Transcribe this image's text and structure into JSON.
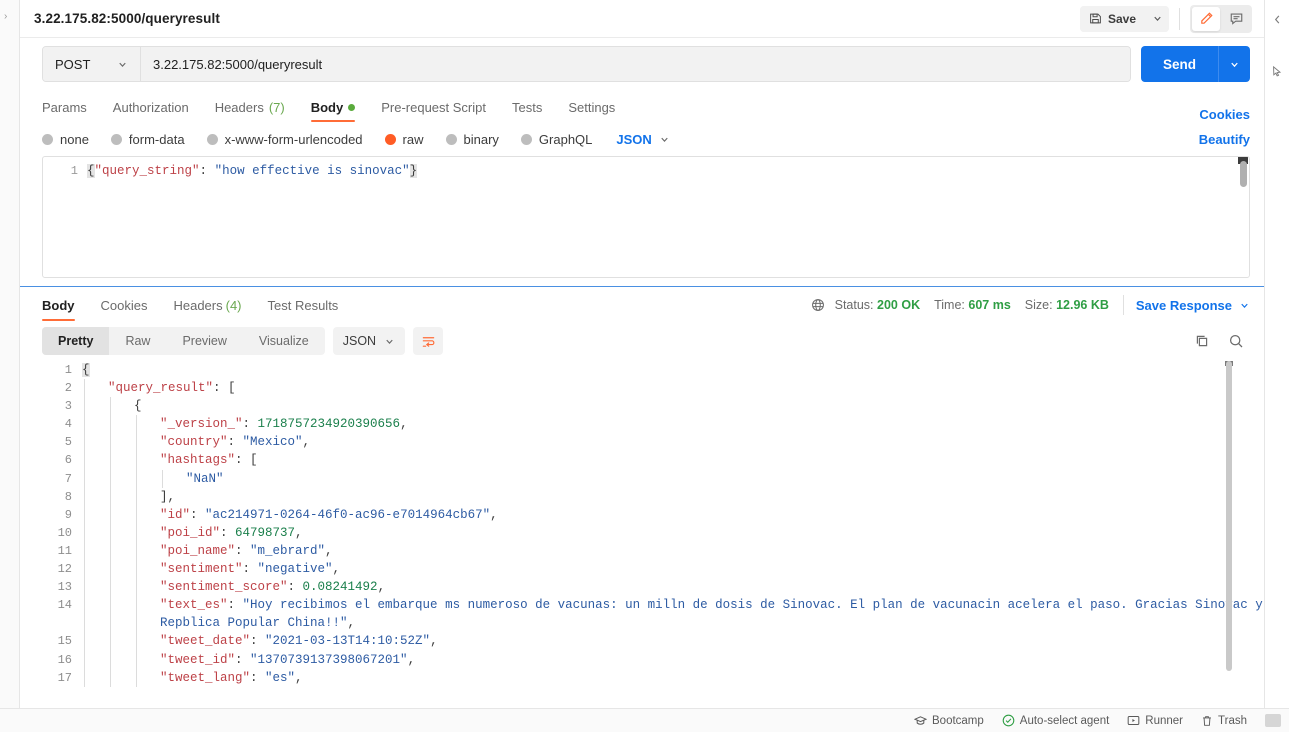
{
  "request": {
    "title": "3.22.175.82:5000/queryresult",
    "method": "POST",
    "url": "3.22.175.82:5000/queryresult",
    "send_label": "Send",
    "save_label": "Save",
    "tabs": [
      {
        "label": "Params",
        "count": "",
        "active": false
      },
      {
        "label": "Authorization",
        "count": "",
        "active": false
      },
      {
        "label": "Headers",
        "count": "(7)",
        "active": false
      },
      {
        "label": "Body",
        "count": "",
        "active": true
      },
      {
        "label": "Pre-request Script",
        "count": "",
        "active": false
      },
      {
        "label": "Tests",
        "count": "",
        "active": false
      },
      {
        "label": "Settings",
        "count": "",
        "active": false
      }
    ],
    "cookies_link": "Cookies",
    "beautify_link": "Beautify",
    "body_types": [
      {
        "label": "none",
        "selected": false
      },
      {
        "label": "form-data",
        "selected": false
      },
      {
        "label": "x-www-form-urlencoded",
        "selected": false
      },
      {
        "label": "raw",
        "selected": true
      },
      {
        "label": "binary",
        "selected": false
      },
      {
        "label": "GraphQL",
        "selected": false
      }
    ],
    "body_format": "JSON",
    "editor": {
      "line_number": "1",
      "key": "\"query_string\"",
      "colon": ": ",
      "value": "\"how effective is sinovac\""
    }
  },
  "response": {
    "tabs": [
      {
        "label": "Body",
        "count": "",
        "active": true
      },
      {
        "label": "Cookies",
        "count": "",
        "active": false
      },
      {
        "label": "Headers",
        "count": "(4)",
        "active": false
      },
      {
        "label": "Test Results",
        "count": "",
        "active": false
      }
    ],
    "status_label": "Status:",
    "status_value": "200 OK",
    "time_label": "Time:",
    "time_value": "607 ms",
    "size_label": "Size:",
    "size_value": "12.96 KB",
    "save_response": "Save Response",
    "viewer_modes": [
      {
        "label": "Pretty",
        "active": true
      },
      {
        "label": "Raw",
        "active": false
      },
      {
        "label": "Preview",
        "active": false
      },
      {
        "label": "Visualize",
        "active": false
      }
    ],
    "viewer_format": "JSON",
    "json_lines": [
      {
        "n": "1",
        "indent": 0,
        "folds": 0,
        "parts": [
          {
            "t": "brace",
            "v": "{"
          }
        ]
      },
      {
        "n": "2",
        "indent": 1,
        "folds": 1,
        "parts": [
          {
            "t": "key",
            "v": "\"query_result\""
          },
          {
            "t": "punc",
            "v": ": ["
          }
        ]
      },
      {
        "n": "3",
        "indent": 2,
        "folds": 2,
        "parts": [
          {
            "t": "punc",
            "v": "{"
          }
        ]
      },
      {
        "n": "4",
        "indent": 3,
        "folds": 3,
        "parts": [
          {
            "t": "key",
            "v": "\"_version_\""
          },
          {
            "t": "punc",
            "v": ": "
          },
          {
            "t": "num",
            "v": "1718757234920390656"
          },
          {
            "t": "punc",
            "v": ","
          }
        ]
      },
      {
        "n": "5",
        "indent": 3,
        "folds": 3,
        "parts": [
          {
            "t": "key",
            "v": "\"country\""
          },
          {
            "t": "punc",
            "v": ": "
          },
          {
            "t": "str",
            "v": "\"Mexico\""
          },
          {
            "t": "punc",
            "v": ","
          }
        ]
      },
      {
        "n": "6",
        "indent": 3,
        "folds": 3,
        "parts": [
          {
            "t": "key",
            "v": "\"hashtags\""
          },
          {
            "t": "punc",
            "v": ": ["
          }
        ]
      },
      {
        "n": "7",
        "indent": 4,
        "folds": 4,
        "parts": [
          {
            "t": "str",
            "v": "\"NaN\""
          }
        ]
      },
      {
        "n": "8",
        "indent": 3,
        "folds": 3,
        "parts": [
          {
            "t": "punc",
            "v": "],"
          }
        ]
      },
      {
        "n": "9",
        "indent": 3,
        "folds": 3,
        "parts": [
          {
            "t": "key",
            "v": "\"id\""
          },
          {
            "t": "punc",
            "v": ": "
          },
          {
            "t": "str",
            "v": "\"ac214971-0264-46f0-ac96-e7014964cb67\""
          },
          {
            "t": "punc",
            "v": ","
          }
        ]
      },
      {
        "n": "10",
        "indent": 3,
        "folds": 3,
        "parts": [
          {
            "t": "key",
            "v": "\"poi_id\""
          },
          {
            "t": "punc",
            "v": ": "
          },
          {
            "t": "num",
            "v": "64798737"
          },
          {
            "t": "punc",
            "v": ","
          }
        ]
      },
      {
        "n": "11",
        "indent": 3,
        "folds": 3,
        "parts": [
          {
            "t": "key",
            "v": "\"poi_name\""
          },
          {
            "t": "punc",
            "v": ": "
          },
          {
            "t": "str",
            "v": "\"m_ebrard\""
          },
          {
            "t": "punc",
            "v": ","
          }
        ]
      },
      {
        "n": "12",
        "indent": 3,
        "folds": 3,
        "parts": [
          {
            "t": "key",
            "v": "\"sentiment\""
          },
          {
            "t": "punc",
            "v": ": "
          },
          {
            "t": "str",
            "v": "\"negative\""
          },
          {
            "t": "punc",
            "v": ","
          }
        ]
      },
      {
        "n": "13",
        "indent": 3,
        "folds": 3,
        "parts": [
          {
            "t": "key",
            "v": "\"sentiment_score\""
          },
          {
            "t": "punc",
            "v": ": "
          },
          {
            "t": "num",
            "v": "0.08241492"
          },
          {
            "t": "punc",
            "v": ","
          }
        ]
      },
      {
        "n": "14",
        "indent": 3,
        "folds": 3,
        "wrapped": true,
        "parts": [
          {
            "t": "key",
            "v": "\"text_es\""
          },
          {
            "t": "punc",
            "v": ": "
          },
          {
            "t": "str",
            "v": "\"Hoy recibimos el embarque ms numeroso de vacunas: un milln de dosis de Sinovac. El plan de vacunacin acelera el paso. Gracias Sinovac y Repblica Popular China!!\""
          },
          {
            "t": "punc",
            "v": ","
          }
        ]
      },
      {
        "n": "15",
        "indent": 3,
        "folds": 3,
        "parts": [
          {
            "t": "key",
            "v": "\"tweet_date\""
          },
          {
            "t": "punc",
            "v": ": "
          },
          {
            "t": "str",
            "v": "\"2021-03-13T14:10:52Z\""
          },
          {
            "t": "punc",
            "v": ","
          }
        ]
      },
      {
        "n": "16",
        "indent": 3,
        "folds": 3,
        "parts": [
          {
            "t": "key",
            "v": "\"tweet_id\""
          },
          {
            "t": "punc",
            "v": ": "
          },
          {
            "t": "str",
            "v": "\"1370739137398067201\""
          },
          {
            "t": "punc",
            "v": ","
          }
        ]
      },
      {
        "n": "17",
        "indent": 3,
        "folds": 3,
        "parts": [
          {
            "t": "key",
            "v": "\"tweet_lang\""
          },
          {
            "t": "punc",
            "v": ": "
          },
          {
            "t": "str",
            "v": "\"es\""
          },
          {
            "t": "punc",
            "v": ","
          }
        ]
      }
    ]
  },
  "status_bar": {
    "items": [
      {
        "label": "Bootcamp",
        "icon": "bootcamp-icon"
      },
      {
        "label": "Auto-select agent",
        "icon": "check-circle-icon"
      },
      {
        "label": "Runner",
        "icon": "runner-icon"
      },
      {
        "label": "Trash",
        "icon": "trash-icon"
      }
    ]
  },
  "colors": {
    "accent_orange": "#ff6c37",
    "link_blue": "#1273ea",
    "status_green": "#2f9e44"
  }
}
